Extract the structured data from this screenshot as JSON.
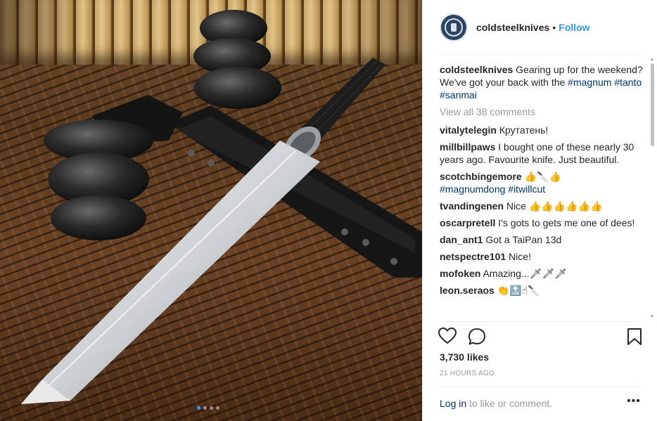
{
  "post": {
    "username": "coldsteelknives",
    "separator": "•",
    "follow_label": "Follow",
    "caption_text": "Gearing up for the weekend? We've got your back with the",
    "hashtags": [
      "#magnum",
      "#tanto",
      "#sanmai"
    ],
    "view_all": "View all 38 comments",
    "carousel": {
      "count": 4,
      "active": 0
    }
  },
  "comments": [
    {
      "user": "vitalytelegin",
      "text": "Крутатень!"
    },
    {
      "user": "millbillpaws",
      "text": "I bought one of these nearly 30 years ago. Favourite knife. Just beautiful."
    },
    {
      "user": "scotchbingemore",
      "text": "👍🔪👍",
      "tags": "#magnumdong #itwillcut"
    },
    {
      "user": "tvandingenen",
      "text": "Nice 👍👍👍👍👍👍"
    },
    {
      "user": "oscarpretell",
      "text": "I's gots to gets me one of dees!"
    },
    {
      "user": "dan_ant1",
      "text": "Got a TaiPan 13d"
    },
    {
      "user": "netspectre101",
      "text": "Nice!"
    },
    {
      "user": "mofoken",
      "text": "Amazing...🗡🗡🗡"
    },
    {
      "user": "leon.seraos",
      "text": "👏🔝☝🔪"
    }
  ],
  "likes": "3,730 likes",
  "timestamp": "21 HOURS AGO",
  "footer": {
    "login": "Log in",
    "rest": " to like or comment.",
    "more": "•••"
  },
  "colors": {
    "accent": "#3897f0",
    "link": "#003569",
    "muted": "#999999"
  }
}
